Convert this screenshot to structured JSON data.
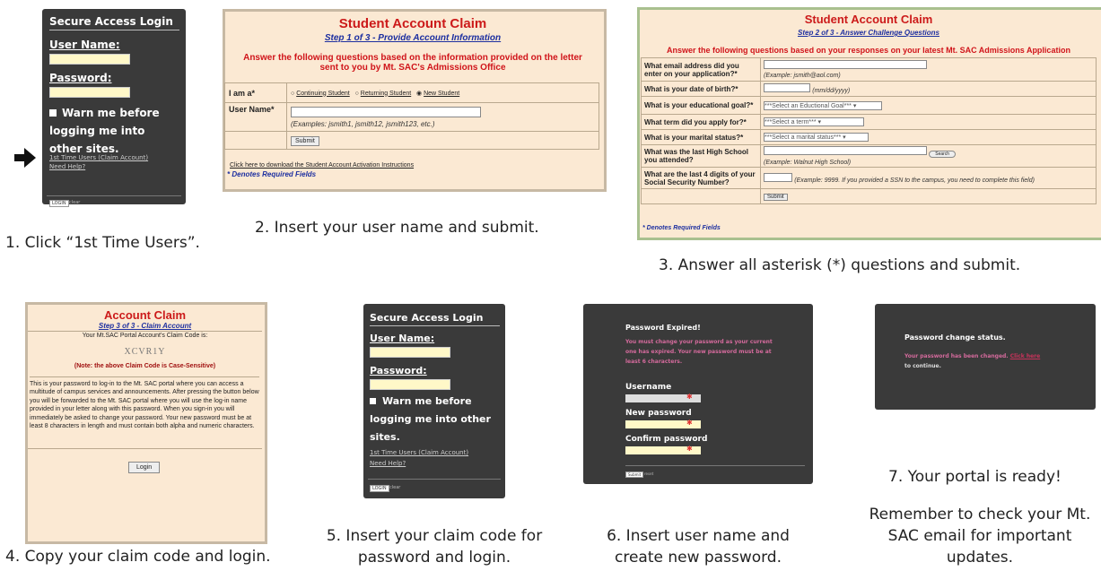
{
  "step1": {
    "title": "Secure Access Login",
    "username_label": "User Name:",
    "password_label": "Password:",
    "warn_text": "Warn me before logging me into other sites.",
    "first_time_link": "1st Time Users (Claim Account)",
    "help_link": "Need Help?",
    "login_button": "LOGIN",
    "clear_link": "clear",
    "caption": "1. Click “1st Time Users”."
  },
  "step2": {
    "title": "Student Account Claim",
    "subtitle": "Step 1 of 3 - Provide Account Information",
    "instructions": "Answer the following questions based on the information provided on the letter sent to you by Mt. SAC's Admissions Office",
    "iam_label": "I am a*",
    "options": [
      "Continuing Student",
      "Returning Student",
      "New Student"
    ],
    "username_label": "User Name*",
    "username_examples": "(Examples: jsmith1, jsmith12, jsmith123, etc.)",
    "submit": "Submit",
    "download_link": "Click here to download the Student Account Activation Instructions",
    "required": "* Denotes Required Fields",
    "caption": "2. Insert your user name and submit."
  },
  "step3": {
    "title": "Student Account Claim",
    "subtitle": "Step 2 of 3 - Answer Challenge Questions",
    "instructions": "Answer the following questions based on your responses on your latest Mt. SAC Admissions Application",
    "questions": [
      {
        "q": "What email address did you enter on your application?*",
        "hint": "(Example: jsmith@aol.com)"
      },
      {
        "q": "What is your date of birth?*",
        "hint": "(mm/dd/yyyy)"
      },
      {
        "q": "What is your educational goal?*",
        "hint": "***Select an Eductional Goal***"
      },
      {
        "q": "What term did you apply for?*",
        "hint": "***Select a term***"
      },
      {
        "q": "What is your marital status?*",
        "hint": "***Select a marital status***"
      },
      {
        "q": "What was the last High School you attended?",
        "hint": "(Example: Walnut High School)"
      },
      {
        "q": "What are the last 4 digits of your Social Security Number?",
        "hint": "(Example: 9999.  If you provided a SSN to the campus, you need to complete this field)"
      }
    ],
    "search_button": "Search",
    "submit": "Submit",
    "required": "* Denotes Required Fields",
    "caption": "3. Answer all asterisk (*) questions and submit."
  },
  "step4": {
    "title": "Account Claim",
    "subtitle": "Step 3 of 3 - Claim Account",
    "code_intro": "Your Mt.SAC Portal Account's Claim Code is:",
    "code": "XCVR1Y",
    "note": "(Note: the above Claim Code is Case-Sensitive)",
    "body": "This is your password to log-in to the Mt. SAC portal where you can access a multitude of campus services and announcements. After pressing the button below you will be forwarded to the Mt. SAC portal where you will use the log-in name provided in your letter along with this password. When you sign-in you will immediately be asked to change your password. Your new password must be at least 8 characters in length and must contain both alpha and numeric characters.",
    "login_button": "Login",
    "caption": "4. Copy your claim code and login."
  },
  "step5": {
    "title": "Secure Access Login",
    "username_label": "User Name:",
    "password_label": "Password:",
    "warn_text": "Warn me before logging me into other sites.",
    "first_time_link": "1st Time Users (Claim Account)",
    "help_link": "Need Help?",
    "login_button": "LOGIN",
    "clear_link": "clear",
    "caption": "5. Insert your claim code for password and login."
  },
  "step6": {
    "title": "Password Expired!",
    "message": "You must change your password as your current one has expired. Your new password must be at least 6 characters.",
    "username_label": "Username",
    "new_password_label": "New password",
    "confirm_label": "Confirm password",
    "submit": "Submit",
    "reset": "reset",
    "caption": "6. Insert user name and create new password."
  },
  "step7": {
    "title": "Password change status.",
    "message_pre": "Your password has been changed.",
    "link": "Click here",
    "message_post": "to continue.",
    "caption_ready": "7. Your portal is ready!",
    "caption_remember": "Remember to check your Mt. SAC email for important updates."
  },
  "colors": {
    "dark_panel": "#3a3a3a",
    "beige": "#fbe9d3",
    "red": "#cc1a1a",
    "blue": "#1d2fa0",
    "field_yellow": "#fff8c8"
  },
  "icons": {
    "arrow": "right-arrow-icon"
  }
}
